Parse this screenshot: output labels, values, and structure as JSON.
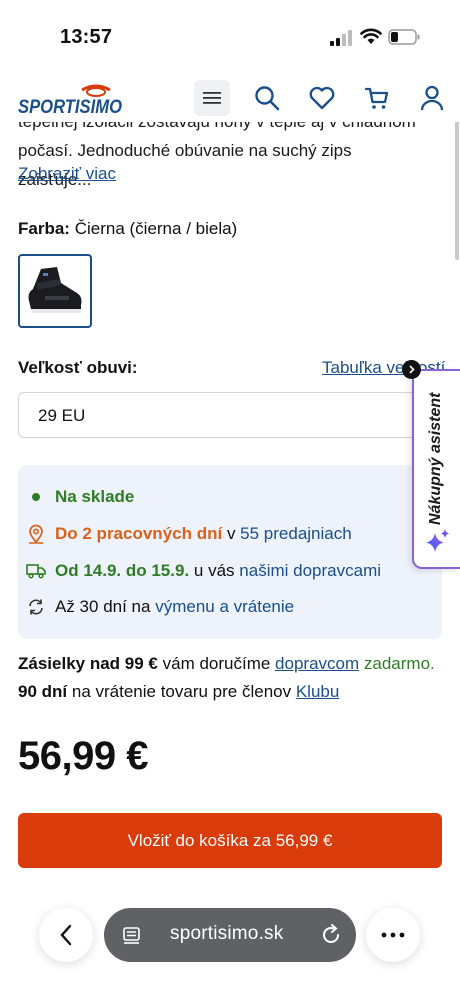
{
  "status_bar": {
    "time": "13:57"
  },
  "header": {
    "logo_text": "SPORTISIMO",
    "icons": [
      "menu-icon",
      "search-icon",
      "heart-icon",
      "cart-icon",
      "user-icon"
    ]
  },
  "product": {
    "desc_line1": "tepelnej izolácii zostávajú nohy v teple aj v chladnom",
    "desc_line2": "počasí. Jednoduché obúvanie na suchý zips zaisťuje...",
    "more_link": "Zobraziť viac",
    "color_label": "Farba:",
    "color_value": "Čierna (čierna / biela)",
    "size_label": "Veľkosť obuvi:",
    "size_table_link": "Tabuľka veľkostí",
    "size_selected": "29 EU"
  },
  "availability": {
    "in_stock": "Na sklade",
    "store_days": "Do 2 pracovných dní",
    "store_mid": "v",
    "store_link": "55 predajniach",
    "delivery_dates": "Od 14.9. do 15.9.",
    "delivery_mid": "u vás",
    "delivery_link": "našimi dopravcami",
    "return_prefix": "Až 30 dní na",
    "return_link": "výmenu a vrátenie"
  },
  "shipping": {
    "line1_bold": "Zásielky nad 99 €",
    "line1_text": "vám doručíme",
    "line1_link": "dopravcom",
    "line1_free": "zadarmo.",
    "line2_bold": "90 dní",
    "line2_text": "na vrátenie tovaru pre členov",
    "line2_link": "Klubu"
  },
  "price": "56,99 €",
  "cart_button": "Vložiť do košíka za 56,99 €",
  "assistant": {
    "label": "Nákupný asistent"
  },
  "browser": {
    "url": "sportisimo.sk"
  },
  "colors": {
    "accent": "#d93b0b",
    "link": "#1a4f8b",
    "green": "#2e7d24",
    "orange": "#d9621a",
    "info_bg": "#eef3fb",
    "assistant_border": "#8b63d9"
  }
}
